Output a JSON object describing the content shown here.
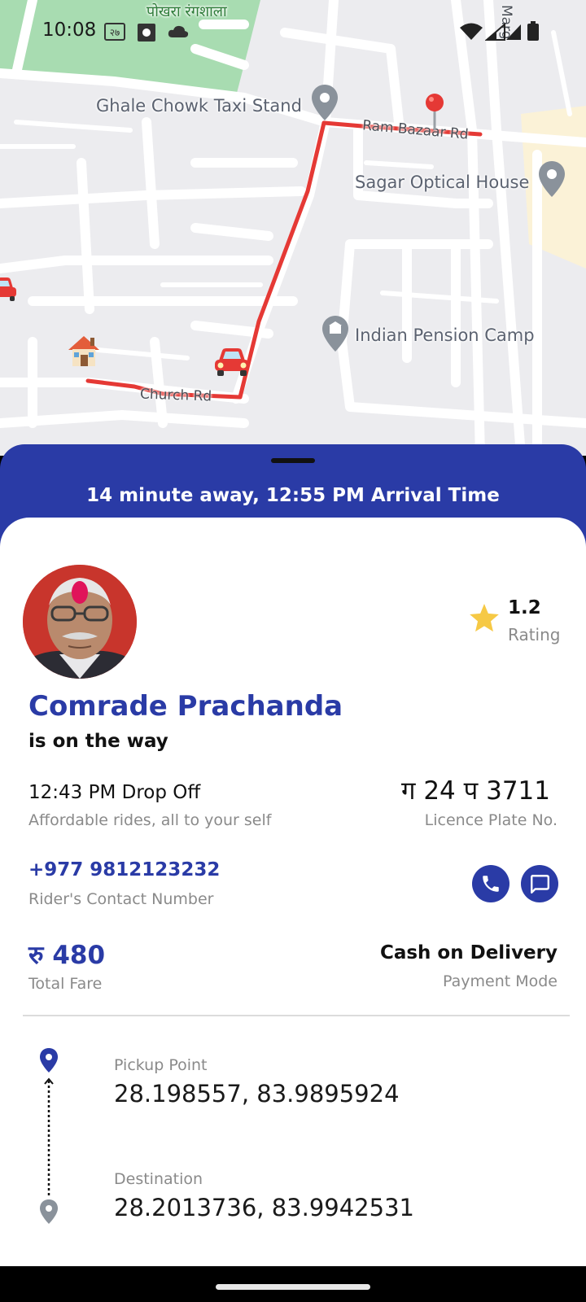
{
  "status_bar": {
    "time": "10:08"
  },
  "map": {
    "park_label": "पोखरा रंगशाला",
    "places": {
      "taxi_stand": "Ghale Chowk Taxi Stand",
      "optical": "Sagar Optical House",
      "pension": "Indian Pension Camp"
    },
    "roads": {
      "ram_bazaar": "Ram Bazaar Rd",
      "church": "Church Rd",
      "marg": "Marg"
    },
    "route_color": "#e53935"
  },
  "trip": {
    "eta": "14 minute away, 12:55 PM Arrival Time"
  },
  "driver": {
    "name": "Comrade Prachanda",
    "status": "is on the way",
    "rating_value": "1.2",
    "rating_label": "Rating",
    "dropoff_time": "12:43 PM Drop Off",
    "dropoff_sub": "Affordable rides, all to your self",
    "plate_no": "ग 24 प 3711",
    "plate_label": "Licence Plate No.",
    "contact_no": "+977 9812123232",
    "contact_label": "Rider's Contact Number"
  },
  "fare": {
    "value": "रु 480",
    "label": "Total Fare",
    "payment_mode": "Cash on Delivery",
    "payment_label": "Payment Mode"
  },
  "route": {
    "pickup_label": "Pickup Point",
    "pickup_coords": "28.198557, 83.9895924",
    "dest_label": "Destination",
    "dest_coords": "28.2013736, 83.9942531"
  },
  "colors": {
    "brand_blue": "#2a3ba6",
    "star_yellow": "#f6c945",
    "muted_text": "#8a8a8a"
  },
  "icons": [
    "wifi-icon",
    "signal-icon",
    "battery-icon",
    "cloud-icon",
    "phone-icon",
    "chat-icon",
    "star-icon",
    "location-pin-icon",
    "car-icon",
    "home-icon"
  ]
}
